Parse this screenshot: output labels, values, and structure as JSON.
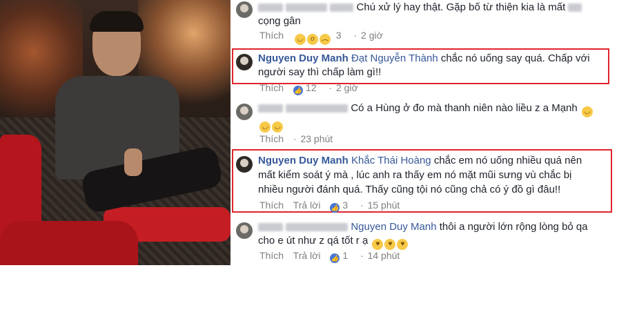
{
  "comments": [
    {
      "author": "",
      "text": "Chú xử lý hay thật. Gặp bố từ thiện kia là mất",
      "text2": "cọng gân",
      "actions": {
        "like_label": "Thích",
        "reaction_count": "3",
        "time": "2 giờ"
      },
      "reactions": [
        "haha-icon",
        "wow-icon",
        "sad-icon"
      ]
    },
    {
      "author": "Nguyen Duy Manh",
      "mention": "Đạt Nguyễn Thành",
      "text": "chắc nó uống say quá. Chấp với",
      "text2": "người say thì chấp làm gì!!",
      "actions": {
        "like_label": "Thích",
        "reaction_count": "12",
        "time": "2 giờ"
      },
      "highlighted": true
    },
    {
      "author": "",
      "text": "Có a Hùng ở đo mà thanh niên nào liều z a Mạnh",
      "actions": {
        "like_label": "Thích",
        "time": "23 phút"
      }
    },
    {
      "author": "Nguyen Duy Manh",
      "mention": "Khắc Thái Hoàng",
      "text": "chắc em nó uống nhiều quá nên",
      "text2": "mất kiểm soát ý mà , lúc anh ra thấy em nó mặt mũi sưng vù chắc bị",
      "text3": "nhiều người đánh quá. Thấy cũng tội nó cũng chả có ý đồ gì đâu!!",
      "actions": {
        "like_label": "Thích",
        "reply_label": "Trả lời",
        "reaction_count": "3",
        "time": "15 phút"
      },
      "highlighted": true
    },
    {
      "author": "",
      "mention": "Nguyen Duy Manh",
      "text": "thôi a người lớn rộng lòng bỏ qa",
      "text2": "cho e út như z qá tốt r ạ",
      "actions": {
        "like_label": "Thích",
        "reply_label": "Trả lời",
        "reaction_count": "1",
        "time": "14 phút"
      }
    }
  ]
}
